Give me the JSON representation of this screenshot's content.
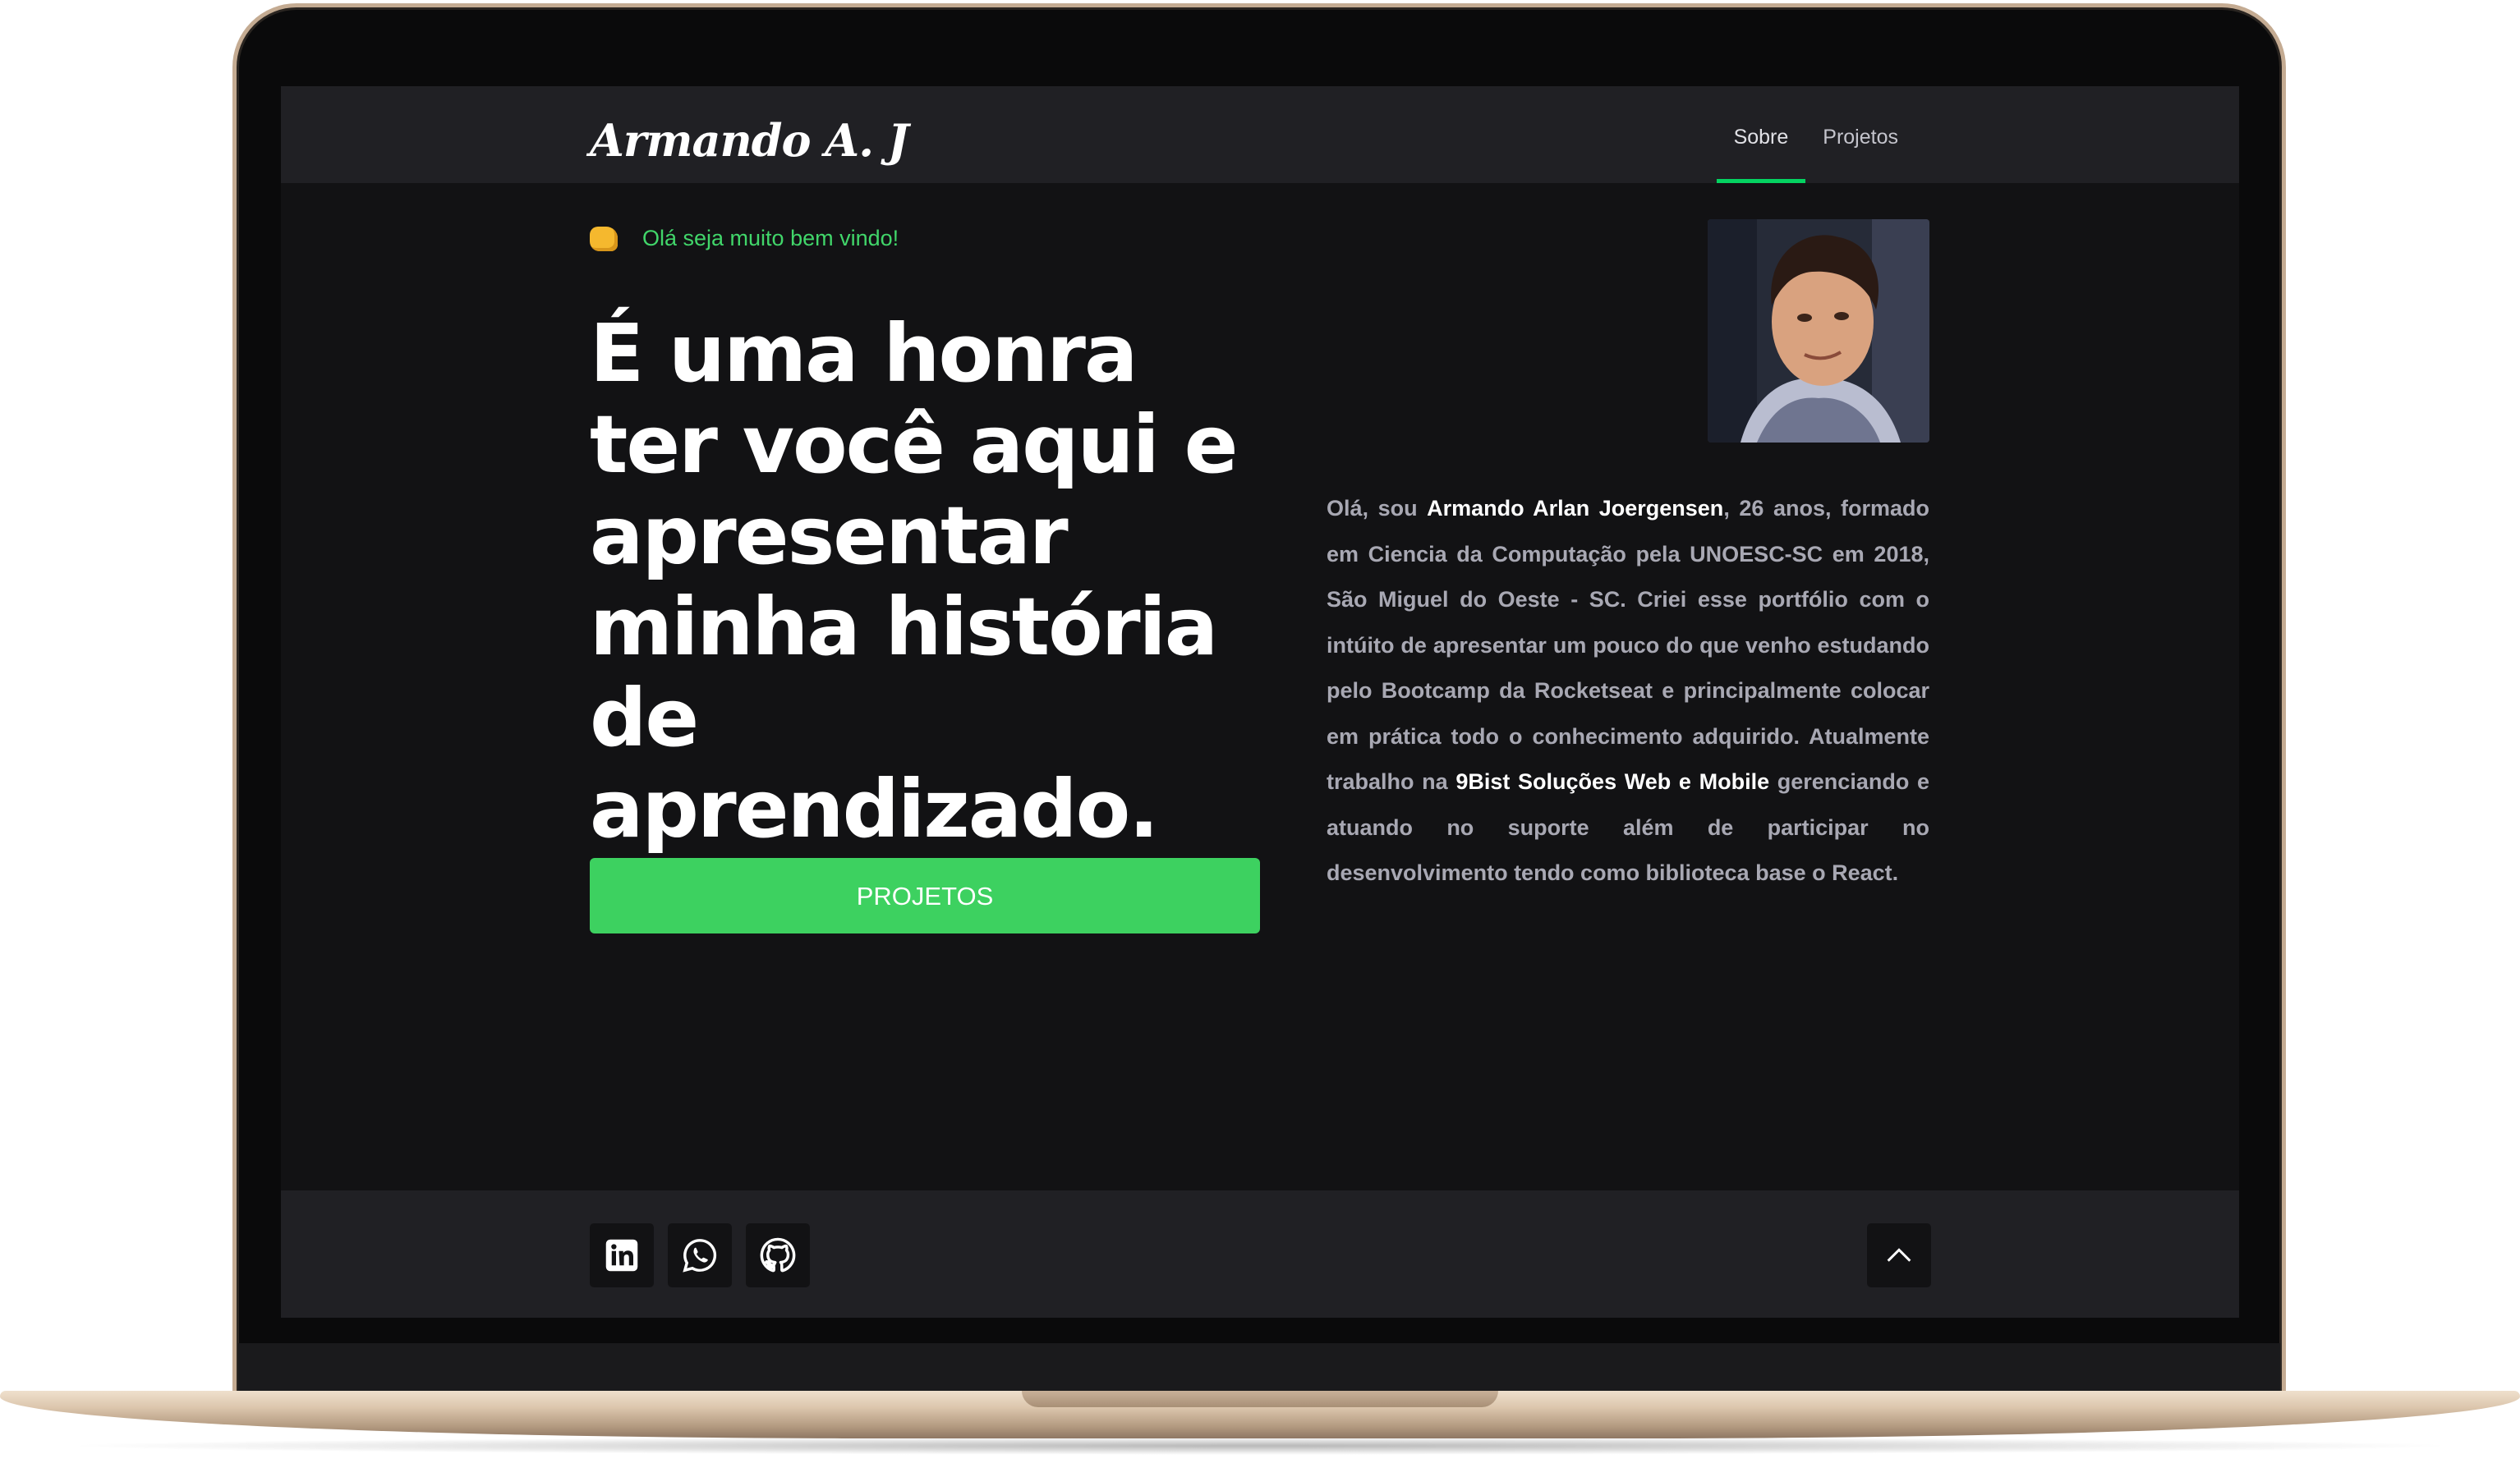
{
  "header": {
    "logo": "Armando A. J",
    "nav": [
      {
        "label": "Sobre",
        "active": true
      },
      {
        "label": "Projetos",
        "active": false
      }
    ]
  },
  "hero": {
    "greeting_icon": "fist-bump-emoji",
    "greeting": "Olá seja muito bem vindo!",
    "headline": "É uma honra ter você aqui e apresentar minha história de aprendizado.",
    "cta_label": "PROJETOS"
  },
  "about": {
    "photo_alt": "avatar",
    "text_intro": "Olá, sou ",
    "name": "Armando Arlan Joergensen",
    "text_middle": ", 26 anos, formado em Ciencia da Computação pela UNOESC-SC em 2018, São Miguel do Oeste - SC. Criei esse portfólio com o intúito de apresentar um pouco do que venho estudando pelo Bootcamp da Rocketseat e principalmente colocar em prática todo o conhecimento adquirido. Atualmente trabalho na ",
    "company": "9Bist Soluções Web e Mobile",
    "text_end": " gerenciando e atuando no suporte além de participar no desenvolvimento tendo como biblioteca base o React."
  },
  "footer": {
    "social": [
      {
        "icon": "linkedin-icon"
      },
      {
        "icon": "whatsapp-icon"
      },
      {
        "icon": "github-icon"
      }
    ],
    "scroll_top_icon": "chevron-up-icon"
  },
  "colors": {
    "accent": "#04d361",
    "button": "#3dd160",
    "background": "#121214",
    "bar": "#202024"
  }
}
